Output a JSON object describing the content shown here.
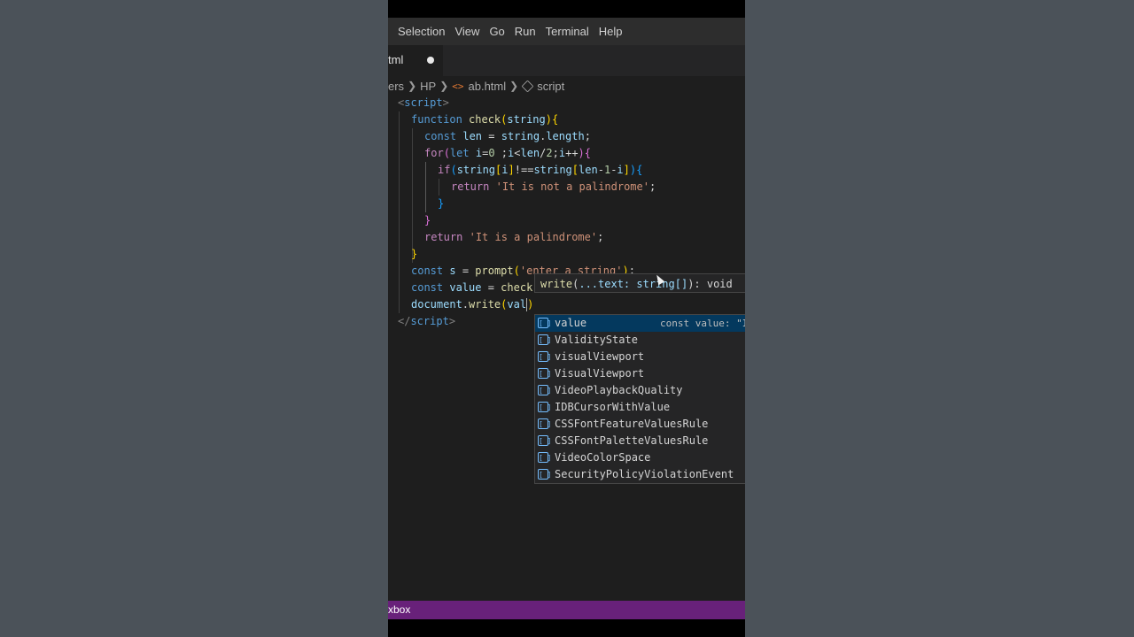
{
  "menu": [
    "Selection",
    "View",
    "Go",
    "Run",
    "Terminal",
    "Help"
  ],
  "tab": {
    "label": "tml"
  },
  "breadcrumb": {
    "parts": [
      "ers",
      "HP",
      "ab.html",
      "script"
    ]
  },
  "code": {
    "open_tag": "script",
    "close_tag": "script",
    "fn_name": "check",
    "param": "string",
    "str_not": "'It is not a palindrome'",
    "str_is": "'It is a palindrome'",
    "str_prompt": "'enter a string'",
    "typed": "val"
  },
  "hint": {
    "name": "write",
    "param": "...text: string[]",
    "ret": "): void"
  },
  "suggestions": [
    {
      "label": "value",
      "detail": "const value: \"I",
      "icon": "variable-icon"
    },
    {
      "label": "ValidityState",
      "icon": "variable-icon"
    },
    {
      "label": "visualViewport",
      "icon": "variable-icon"
    },
    {
      "label": "VisualViewport",
      "icon": "variable-icon"
    },
    {
      "label": "VideoPlaybackQuality",
      "icon": "variable-icon"
    },
    {
      "label": "IDBCursorWithValue",
      "icon": "variable-icon"
    },
    {
      "label": "CSSFontFeatureValuesRule",
      "icon": "variable-icon"
    },
    {
      "label": "CSSFontPaletteValuesRule",
      "icon": "variable-icon"
    },
    {
      "label": "VideoColorSpace",
      "icon": "variable-icon"
    },
    {
      "label": "SecurityPolicyViolationEvent",
      "icon": "variable-icon"
    }
  ],
  "status": {
    "left": "xbox"
  },
  "colors": {
    "statusbar": "#68217a",
    "editor_bg": "#1e1e1e",
    "selection": "#04395e"
  }
}
